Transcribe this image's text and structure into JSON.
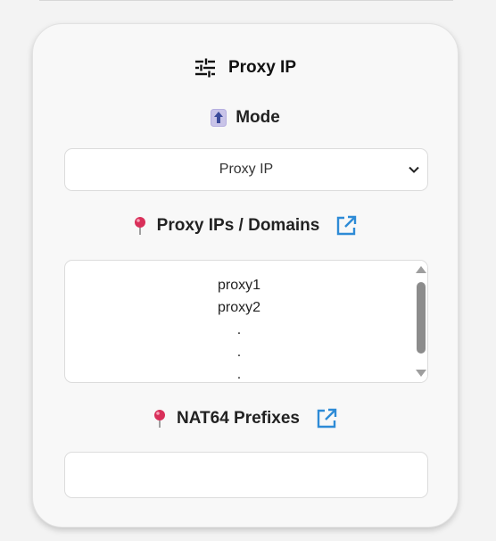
{
  "panel": {
    "title": "Proxy IP",
    "title_icon": "sliders-icon"
  },
  "mode": {
    "label": "Mode",
    "icon": "up-arrow-emoji-icon",
    "selected_value": "Proxy IP"
  },
  "proxies": {
    "label": "Proxy IPs / Domains",
    "icon": "round-pushpin-icon",
    "link_icon": "external-link-icon",
    "lines": [
      "proxy1",
      "proxy2",
      ".",
      ".",
      "."
    ]
  },
  "nat64": {
    "label": "NAT64 Prefixes",
    "icon": "round-pushpin-icon",
    "link_icon": "external-link-icon",
    "value": "",
    "placeholder": ""
  },
  "colors": {
    "link_blue": "#2e8bd6",
    "pin_red": "#d9305a",
    "mode_icon_bg": "#c9c4e8"
  }
}
